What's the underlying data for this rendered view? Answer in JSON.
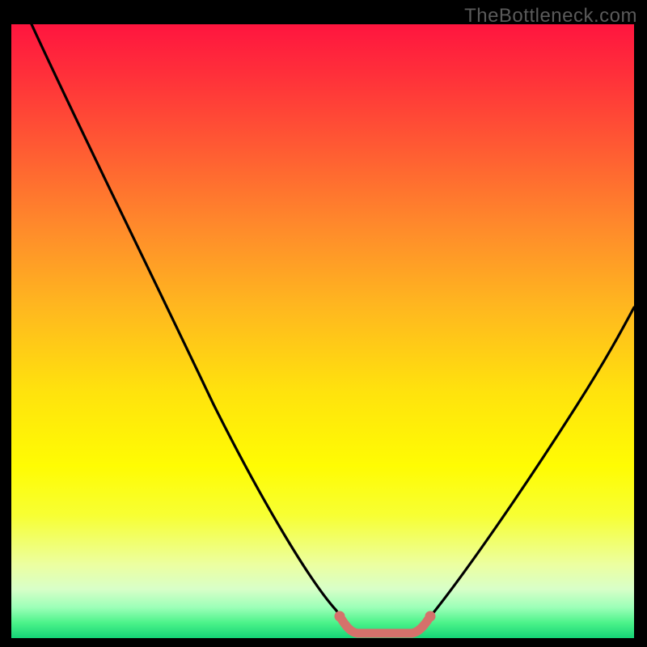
{
  "watermark": "TheBottleneck.com",
  "chart_data": {
    "type": "line",
    "title": "",
    "xlabel": "",
    "ylabel": "",
    "xlim": [
      0,
      100
    ],
    "ylim": [
      0,
      100
    ],
    "background_gradient": {
      "top": "#ff153f",
      "middle": "#ffe30d",
      "bottom": "#15d477"
    },
    "series": [
      {
        "name": "curve",
        "color": "#000000",
        "x": [
          3,
          10,
          20,
          30,
          40,
          50,
          52,
          57,
          59,
          63,
          65,
          70,
          80,
          90,
          100
        ],
        "y": [
          100,
          87,
          71,
          54,
          36,
          15,
          5,
          1,
          0,
          0,
          1,
          6,
          20,
          37,
          55
        ]
      }
    ],
    "marker_segment": {
      "color": "#d5716b",
      "x_range": [
        52,
        65
      ],
      "y": 0.5
    }
  }
}
